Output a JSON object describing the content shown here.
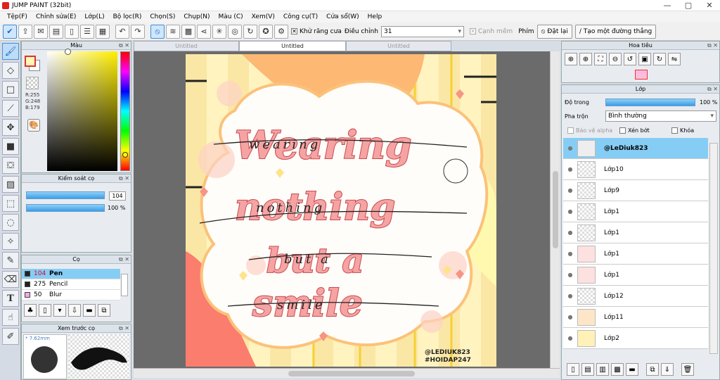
{
  "window": {
    "title": "JUMP PAINT (32bit)",
    "min": "—",
    "max": "▢",
    "close": "✕"
  },
  "menu": [
    "Tệp(F)",
    "Chỉnh sửa(E)",
    "Lớp(L)",
    "Bộ lọc(R)",
    "Chọn(S)",
    "Chụp(N)",
    "Màu (C)",
    "Xem(V)",
    "Công cụ(T)",
    "Cửa sổ(W)",
    "Help"
  ],
  "toolbar": {
    "antialias_label": "Khử răng cưa",
    "adjust_label": "Điều chỉnh",
    "adjust_value": "31",
    "soft_edge_label": "Cạnh mềm",
    "keys_label": "Phím",
    "reset_label": "Đặt lại",
    "straight_line_label": "Tạo một đường thẳng"
  },
  "color_panel": {
    "title": "Màu",
    "r": "R:255",
    "g": "G:248",
    "b": "B:179",
    "fg": "#fff8b3"
  },
  "brush_control": {
    "title": "Kiểm soát cọ",
    "size": "104",
    "opacity": "100 %"
  },
  "brush_panel": {
    "title": "Cọ",
    "items": [
      {
        "size": "104",
        "name": "Pen",
        "color": "#222222"
      },
      {
        "size": "275",
        "name": "Pencil",
        "color": "#222222"
      },
      {
        "size": "50",
        "name": "Blur",
        "color": "#f4a8e8"
      }
    ]
  },
  "brush_preview": {
    "title": "Xem trước cọ",
    "size": "* 7.62mm"
  },
  "tabs": [
    "Untitled",
    "Untitled",
    "Untitled"
  ],
  "artwork": {
    "lines": [
      "Wearing",
      "nothing",
      "but a",
      "smile"
    ],
    "script": [
      "wearing",
      "nothing",
      "but a",
      "smile"
    ],
    "credit_1": "@LEDIUK823",
    "credit_2": "#HOIDAP247"
  },
  "navigator": {
    "title": "Hoa tiêu"
  },
  "layers_panel": {
    "title": "Lớp",
    "opacity_label": "Độ trong",
    "opacity_value": "100 %",
    "blend_label": "Pha trộn",
    "blend_value": "Bình thường",
    "protect_alpha": "Bảo vệ alpha",
    "clip": "Xén bớt",
    "lock": "Khóa",
    "layers": [
      "@LeDiuk823",
      "Lớp10",
      "Lớp9",
      "Lớp1",
      "Lớp1",
      "Lớp1",
      "Lớp1",
      "Lớp12",
      "Lớp11",
      "Lớp2"
    ]
  }
}
